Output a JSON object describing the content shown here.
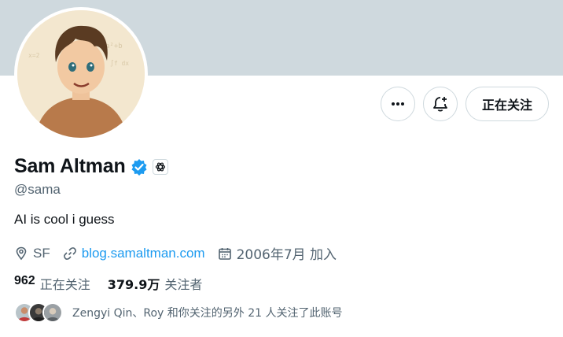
{
  "profile": {
    "name": "Sam Altman",
    "handle": "@sama",
    "bio": "AI is cool i guess",
    "location": "SF",
    "website": "blog.samaltman.com",
    "joined": "2006年7月 加入"
  },
  "actions": {
    "more_icon": "more-horizontal-icon",
    "notify_icon": "bell-plus-icon",
    "follow_label": "正在关注"
  },
  "stats": {
    "following_count": "962",
    "following_label": "正在关注",
    "followers_count": "379.9万",
    "followers_label": "关注者"
  },
  "followed_by": {
    "text": "Zengyi Qin、Roy 和你关注的另外 21 人关注了此账号"
  },
  "colors": {
    "banner": "#cfd9de",
    "link": "#1d9bf0",
    "verified": "#1d9bf0",
    "secondary_text": "#536471"
  }
}
